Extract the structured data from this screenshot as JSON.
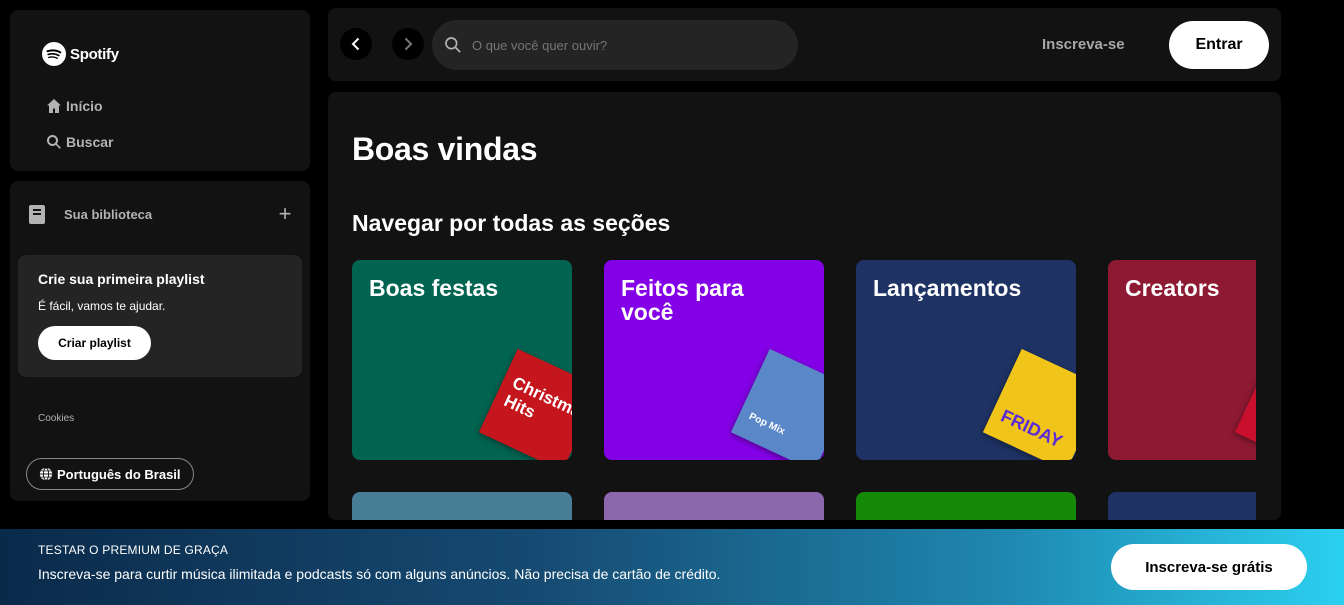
{
  "sidebar": {
    "logo_text": "Spotify",
    "nav": [
      {
        "label": "Início",
        "icon": "home-icon"
      },
      {
        "label": "Buscar",
        "icon": "search-icon"
      }
    ]
  },
  "library": {
    "title": "Sua biblioteca",
    "add_icon": "plus-icon",
    "playlist_card": {
      "title": "Crie sua primeira playlist",
      "subtitle": "É fácil, vamos te ajudar.",
      "button": "Criar playlist"
    },
    "cookies": "Cookies",
    "language_button": "Português do Brasil"
  },
  "topbar": {
    "search_placeholder": "O que você quer ouvir?",
    "signup": "Inscreva-se",
    "login": "Entrar"
  },
  "main": {
    "welcome": "Boas vindas",
    "section_title": "Navegar por todas as seções",
    "cards": [
      {
        "title": "Boas festas",
        "color": "#006450",
        "art_text": "Christmas Hits",
        "art_color": "#c4161c"
      },
      {
        "title": "Feitos para você",
        "color": "#8400e7",
        "art_text": "Pop Mix",
        "art_color": "#5a87c8"
      },
      {
        "title": "Lançamentos",
        "color": "#1e3264",
        "art_text": "FRIDAY",
        "art_color": "#f0c419"
      },
      {
        "title": "Creators",
        "color": "#8d1932",
        "art_text": "",
        "art_color": "#c8102e"
      }
    ],
    "row2_colors": [
      "#477d95",
      "#8c67ab",
      "#148a08",
      "#1e3264"
    ]
  },
  "banner": {
    "eyebrow": "TESTAR O PREMIUM DE GRAÇA",
    "text": "Inscreva-se para curtir música ilimitada e podcasts só com alguns anúncios. Não precisa de cartão de crédito.",
    "button": "Inscreva-se grátis"
  }
}
